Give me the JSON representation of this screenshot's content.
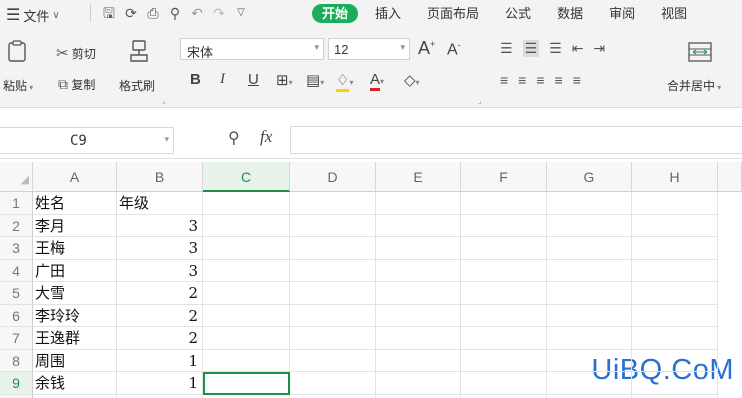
{
  "menubar": {
    "file_label": "文件",
    "tabs": [
      "开始",
      "插入",
      "页面布局",
      "公式",
      "数据",
      "审阅",
      "视图"
    ],
    "active_tab": "开始"
  },
  "ribbon": {
    "paste": "粘贴",
    "cut": "剪切",
    "copy": "复制",
    "format_painter": "格式刷",
    "font_name": "宋体",
    "font_size": "12",
    "grow_font": "A",
    "shrink_font": "A",
    "bold": "B",
    "italic": "I",
    "underline": "U",
    "font_color_letter": "A",
    "merge_center": "合并居中"
  },
  "formula_bar": {
    "name_box": "C9",
    "fx_label": "fx",
    "value": ""
  },
  "sheet": {
    "columns": [
      "A",
      "B",
      "C",
      "D",
      "E",
      "F",
      "G",
      "H"
    ],
    "selected_column": "C",
    "selected_cell": "C9",
    "rows": [
      {
        "n": "1",
        "a": "姓名",
        "b": "年级"
      },
      {
        "n": "2",
        "a": "李月",
        "b": "3"
      },
      {
        "n": "3",
        "a": "王梅",
        "b": "3"
      },
      {
        "n": "4",
        "a": "广田",
        "b": "3"
      },
      {
        "n": "5",
        "a": "大雪",
        "b": "2"
      },
      {
        "n": "6",
        "a": "李玲玲",
        "b": "2"
      },
      {
        "n": "7",
        "a": "王逸群",
        "b": "2"
      },
      {
        "n": "8",
        "a": "周围",
        "b": "1"
      },
      {
        "n": "9",
        "a": "余钱",
        "b": "1"
      }
    ]
  },
  "watermark": "UiBQ.CoM",
  "colors": {
    "accent_green": "#1aad5b",
    "selection_green": "#1e8e4a",
    "watermark_blue": "#2b6fd1"
  }
}
